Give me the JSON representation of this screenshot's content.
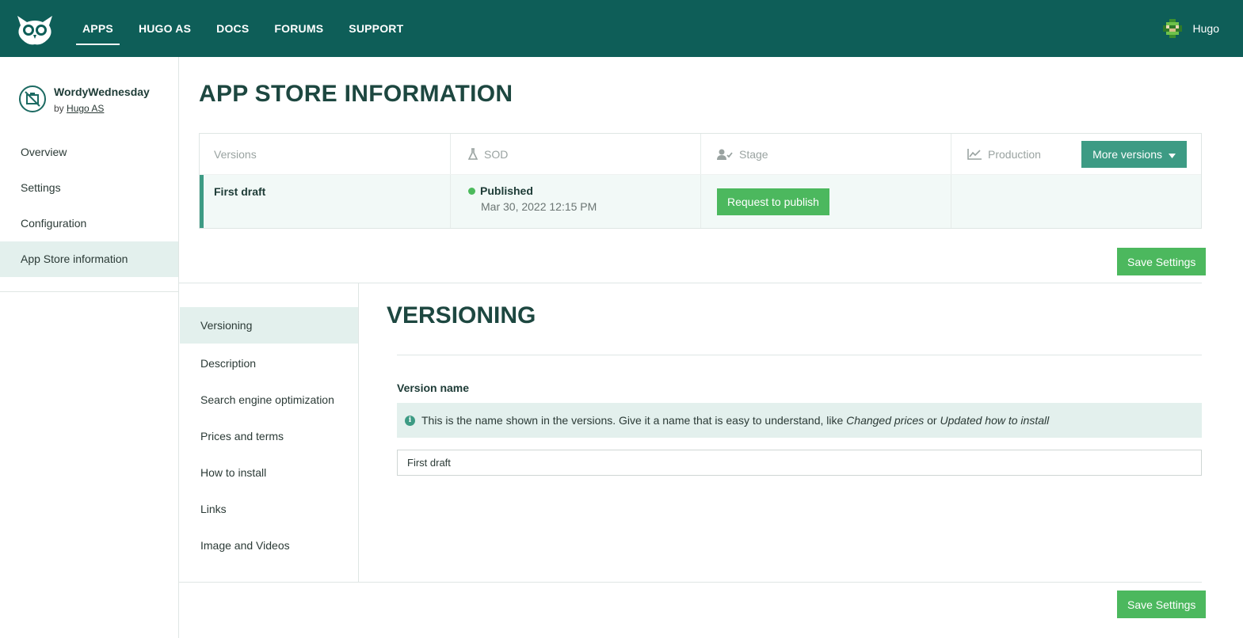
{
  "topbar": {
    "nav": [
      {
        "label": "APPS",
        "active": true
      },
      {
        "label": "HUGO AS"
      },
      {
        "label": "DOCS"
      },
      {
        "label": "FORUMS"
      },
      {
        "label": "SUPPORT"
      }
    ],
    "user_name": "Hugo"
  },
  "sidebar": {
    "app_name": "WordyWednesday",
    "by_prefix": "by",
    "by_name": "Hugo AS",
    "items": [
      {
        "label": "Overview"
      },
      {
        "label": "Settings"
      },
      {
        "label": "Configuration"
      },
      {
        "label": "App Store information",
        "active": true
      }
    ]
  },
  "main": {
    "title": "APP STORE INFORMATION",
    "versions": {
      "headers": {
        "versions": "Versions",
        "sod": "SOD",
        "stage": "Stage",
        "production": "Production"
      },
      "more_versions": "More versions",
      "row": {
        "name": "First draft",
        "status": "Published",
        "date": "Mar 30, 2022 12:15 PM",
        "request_button": "Request to publish"
      }
    },
    "save_label": "Save Settings",
    "subnav": [
      {
        "label": "Versioning",
        "active": true
      },
      {
        "label": "Description"
      },
      {
        "label": "Search engine optimization"
      },
      {
        "label": "Prices and terms"
      },
      {
        "label": "How to install"
      },
      {
        "label": "Links"
      },
      {
        "label": "Image and Videos"
      }
    ],
    "section": {
      "title": "VERSIONING",
      "field_label": "Version name",
      "info_text": "This is the name shown in the versions. Give it a name that is easy to understand, like",
      "info_example1": "Changed prices",
      "info_or": "or",
      "info_example2": "Updated how to install",
      "input_value": "First draft"
    }
  },
  "colors": {
    "brand": "#0e5e58",
    "accent": "#3d9b84",
    "success": "#4cb85e",
    "selected_bg": "#e3f0ed"
  }
}
